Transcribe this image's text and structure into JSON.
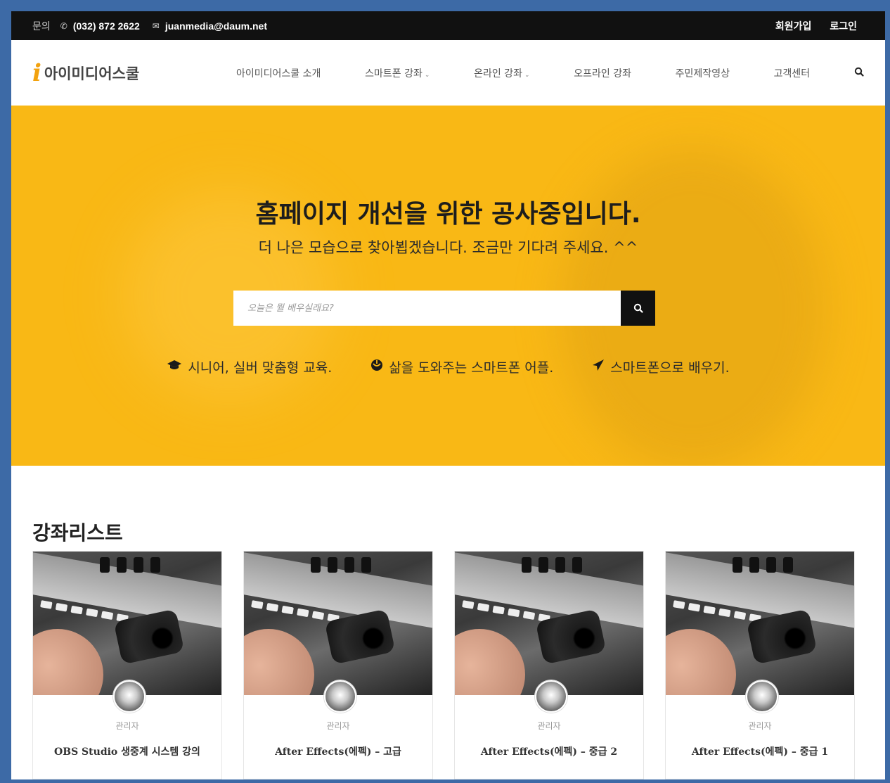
{
  "topbar": {
    "contact_label": "문의",
    "phone": "(032) 872 2622",
    "email": "juanmedia@daum.net",
    "signup": "회원가입",
    "login": "로그인"
  },
  "header": {
    "logo_mark": "i",
    "logo_text": "아이미디어스쿨",
    "nav": [
      {
        "label": "아이미디어스쿨 소개"
      },
      {
        "label": "스마트폰 강좌",
        "chevron": "⌄"
      },
      {
        "label": "온라인 강좌",
        "chevron": "⌄"
      },
      {
        "label": "오프라인 강좌"
      },
      {
        "label": "주민제작영상"
      },
      {
        "label": "고객센터"
      }
    ]
  },
  "hero": {
    "title": "홈페이지 개선을 위한 공사중입니다.",
    "subtitle": "더 나은 모습으로 찾아뵙겠습니다. 조금만 기다려 주세요. ^^",
    "search_placeholder": "오늘은 뭘 배우실래요?",
    "features": [
      {
        "icon": "graduation-cap-icon",
        "label": "시니어, 실버 맞춤형 교육."
      },
      {
        "icon": "rebel-icon",
        "label": "삶을 도와주는 스마트폰 어플."
      },
      {
        "icon": "paper-plane-icon",
        "label": "스마트폰으로 배우기."
      }
    ]
  },
  "courses": {
    "section_title": "강좌리스트",
    "items": [
      {
        "author": "관리자",
        "title": "OBS Studio 생중계 시스템 강의"
      },
      {
        "author": "관리자",
        "title": "After Effects(에펙) – 고급"
      },
      {
        "author": "관리자",
        "title": "After Effects(에펙) – 중급 2"
      },
      {
        "author": "관리자",
        "title": "After Effects(에펙) – 중급 1"
      }
    ]
  },
  "colors": {
    "hero_bg": "#f9b815",
    "topbar_bg": "#111111",
    "frame_border": "#3d6aa6"
  }
}
